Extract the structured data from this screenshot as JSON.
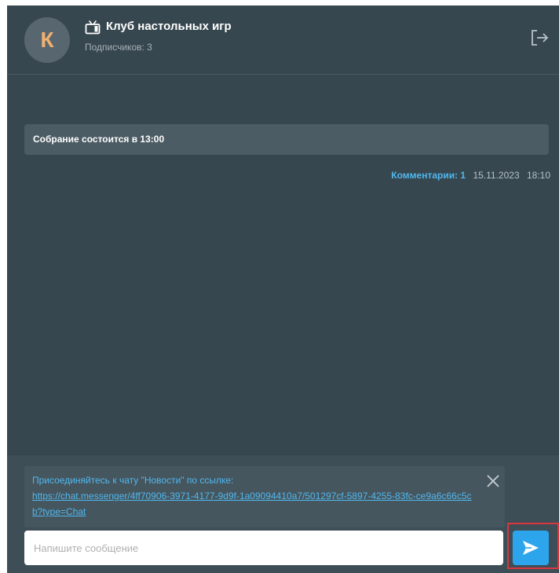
{
  "header": {
    "avatar_letter": "К",
    "channel_icon": "tv-icon",
    "title": "Клуб настольных игр",
    "subscribers": "Подписчиков: 3",
    "leave_icon": "logout-icon"
  },
  "messages": [
    {
      "text": "Собрание состоится в 13:00",
      "comments": "Комментарии: 1",
      "date": "15.11.2023",
      "time": "18:10"
    }
  ],
  "composer": {
    "reply_text": "Присоединяйтесь к чату \"Новости\" по ссылке:",
    "reply_link": "https://chat.messenger/4ff70906-3971-4177-9d9f-1a09094410a7/501297cf-5897-4255-83fc-ce9a6c66c5cb?type=Chat",
    "close_icon": "close-icon",
    "placeholder": "Напишите сообщение",
    "send_icon": "send-icon"
  },
  "colors": {
    "background": "#37474f",
    "accent": "#2da5ec",
    "link": "#4fb8ef",
    "highlight": "#d9363e",
    "avatar_letter": "#f0b070"
  }
}
